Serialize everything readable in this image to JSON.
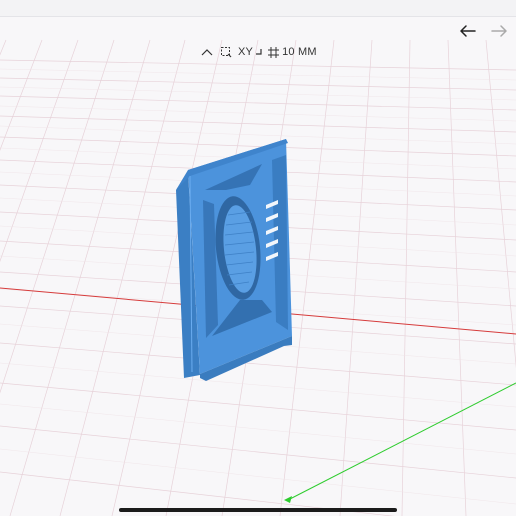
{
  "toolbar": {
    "plane_label": "XY",
    "grid_label": "10 MM"
  },
  "icons": {
    "collapse": "chevron-up-icon",
    "select": "selection-box-icon",
    "plane": "plane-icon",
    "grid": "grid-size-icon",
    "undo": "arrow-left-icon",
    "redo": "arrow-right-icon"
  },
  "colors": {
    "model": "#4a90d8",
    "x_axis": "#d63b3b",
    "y_axis": "#2ecc2e",
    "grid": "#e6cdd5"
  }
}
